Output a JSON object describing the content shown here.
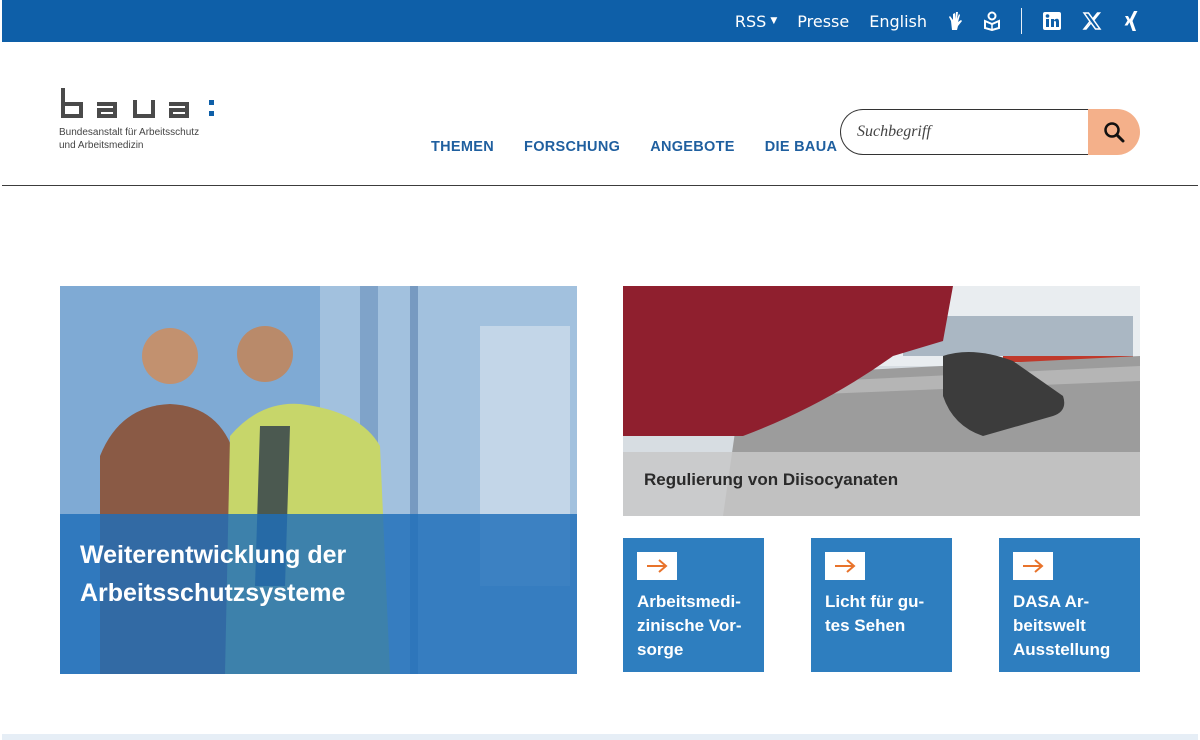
{
  "topbar": {
    "rss_label": "RSS",
    "press_label": "Presse",
    "language_label": "English",
    "icons": [
      "sign-language-icon",
      "easy-language-icon",
      "linkedin-icon",
      "x-icon",
      "xing-icon"
    ]
  },
  "logo": {
    "wordmark": "baua:",
    "subtitle_line1": "Bundesanstalt für Arbeitsschutz",
    "subtitle_line2": "und Arbeitsmedizin"
  },
  "nav": {
    "items": [
      "THEMEN",
      "FORSCHUNG",
      "ANGEBOTE",
      "DIE BAUA"
    ]
  },
  "search": {
    "placeholder": "Suchbegriff",
    "value": ""
  },
  "tiles": {
    "hero": {
      "title": "Weiterentwicklung der Arbeitsschutzsysteme"
    },
    "regulation": {
      "title": "Regulierung von Diisocyanaten"
    },
    "small": [
      {
        "title": "Arbeitsmedi-zinische Vor-sorge"
      },
      {
        "title": "Licht für gu-tes Sehen"
      },
      {
        "title": "DASA Ar-beitswelt Ausstellung"
      }
    ]
  },
  "colors": {
    "brand_blue": "#0e5fa8",
    "tile_blue": "#2e7ebf",
    "nav_blue": "#1f5f9f",
    "search_button": "#f4b08a",
    "arrow_orange": "#e8732b"
  }
}
